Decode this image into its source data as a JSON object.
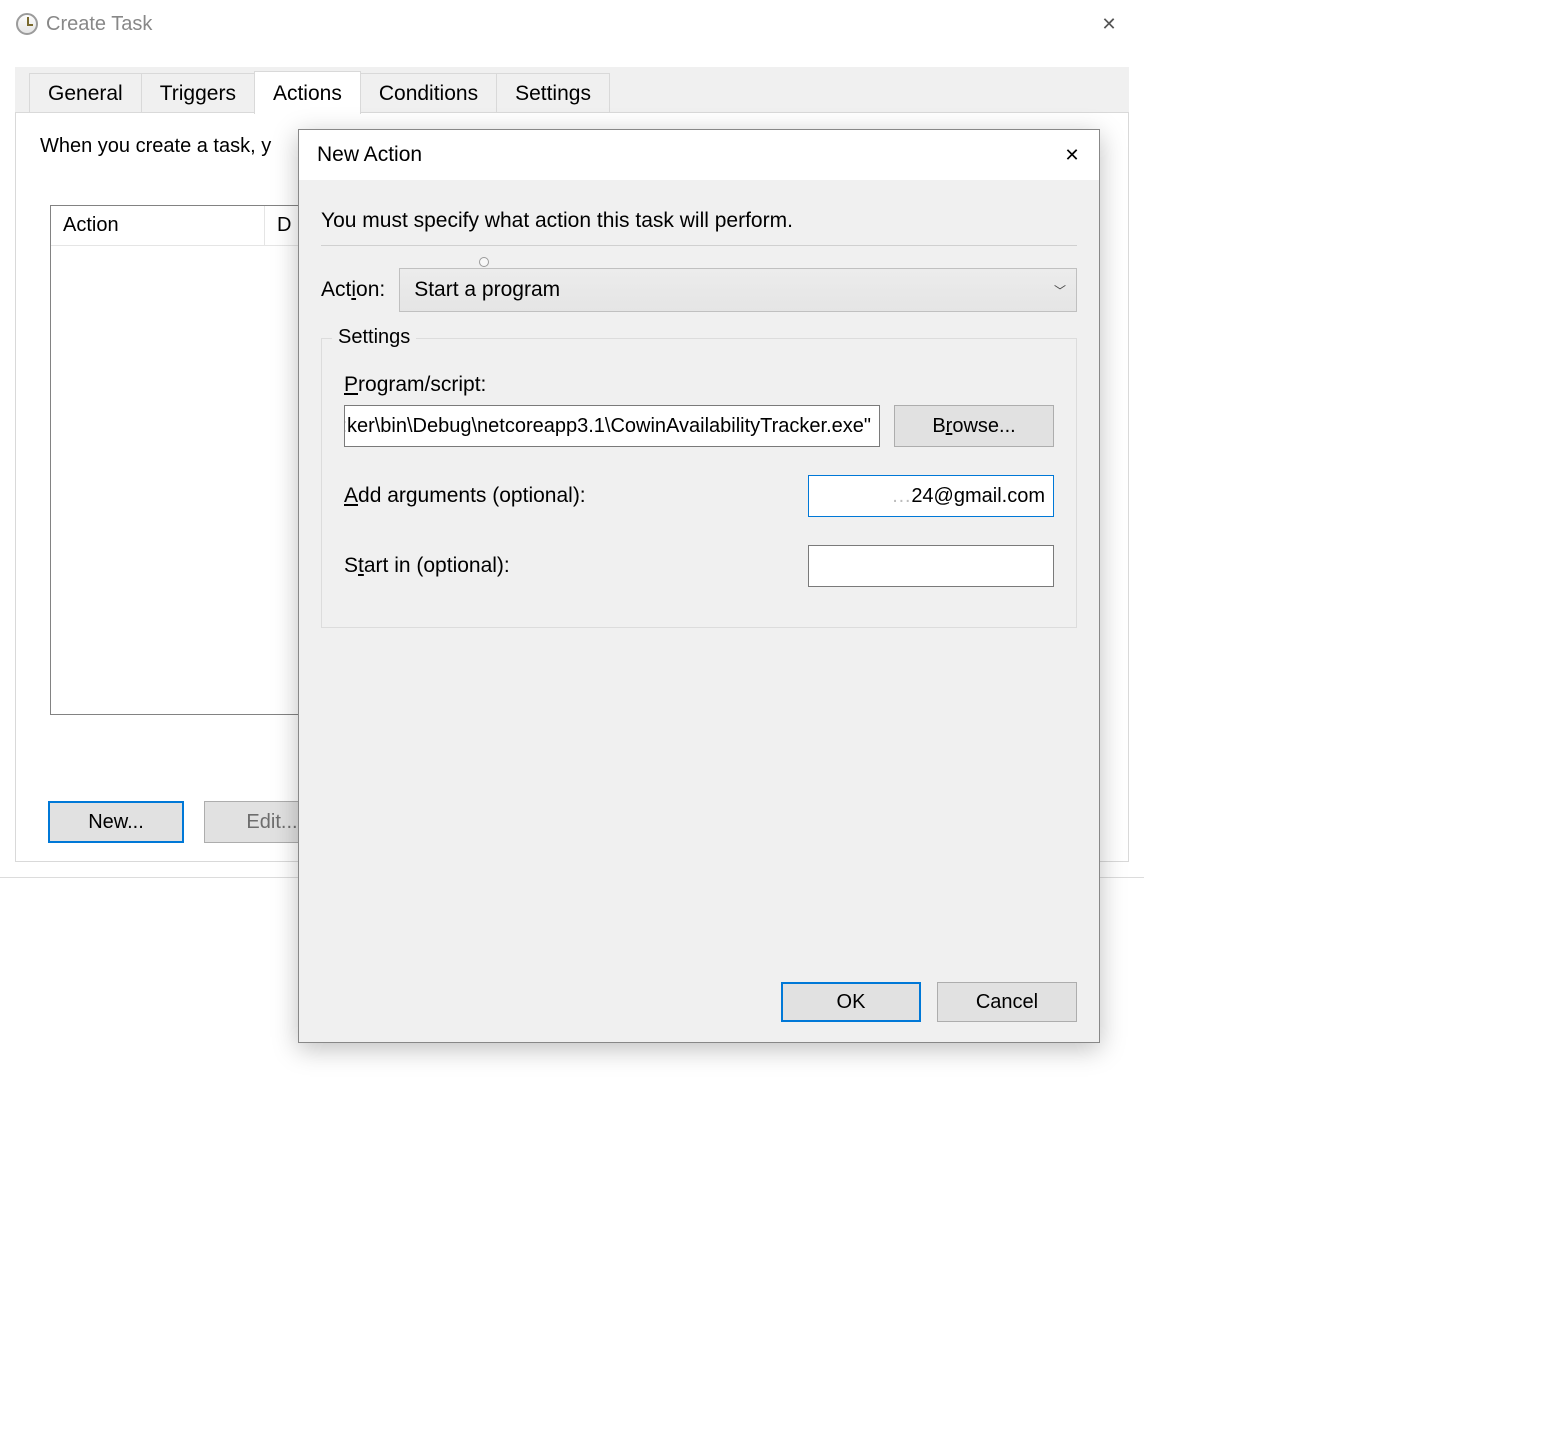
{
  "create_task": {
    "title": "Create Task",
    "close_glyph": "✕",
    "tabs": {
      "general": "General",
      "triggers": "Triggers",
      "actions": "Actions",
      "conditions": "Conditions",
      "settings": "Settings",
      "active_index": 2
    },
    "panel": {
      "instruction_visible": "When you create a task, y",
      "table": {
        "col1": "Action",
        "col2_visible": "D"
      },
      "buttons": {
        "new": "New...",
        "edit": "Edit..."
      }
    }
  },
  "new_action": {
    "title": "New Action",
    "close_glyph": "✕",
    "instruction": "You must specify what action this task will perform.",
    "action_label": "Action:",
    "action_label_underline_char": "i",
    "action_dropdown": {
      "selected": "Start a program"
    },
    "settings_group": {
      "legend": "Settings",
      "program_label": "Program/script:",
      "program_label_underline_char": "P",
      "program_value_tail": ":ker\\bin\\Debug\\netcoreapp3.1\\CowinAvailabilityTracker.exe\"",
      "browse": "Browse...",
      "browse_underline_char": "r",
      "args_label": "Add arguments (optional):",
      "args_label_underline_char": "A",
      "args_value_tail": "24@gmail.com",
      "args_value_obscured_prefix": "…",
      "startin_label": "Start in (optional):",
      "startin_label_underline_char": "t",
      "startin_value": ""
    },
    "footer": {
      "ok": "OK",
      "cancel": "Cancel"
    }
  }
}
